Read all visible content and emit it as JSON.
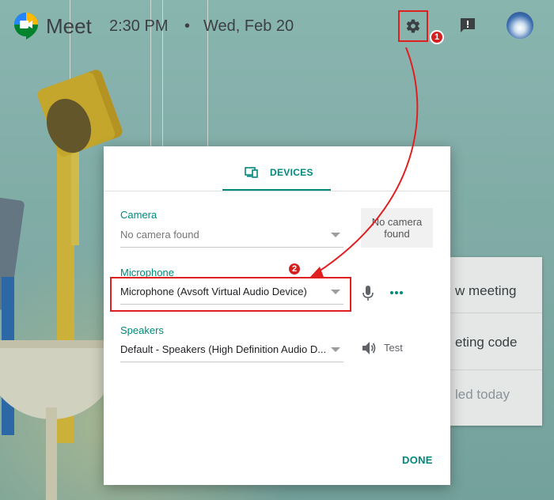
{
  "header": {
    "app_name": "Meet",
    "time": "2:30 PM",
    "separator": "•",
    "date": "Wed, Feb 20",
    "settings_icon": "gear-icon",
    "feedback_icon": "feedback-icon",
    "avatar_icon": "avatar"
  },
  "annotations": {
    "step1": "1",
    "step2": "2",
    "color": "#e02020"
  },
  "background_card": {
    "rows": [
      "w meeting",
      "eting code",
      "led today"
    ]
  },
  "dialog": {
    "tab_label": "DEVICES",
    "tab_icon": "devices-icon",
    "camera": {
      "label": "Camera",
      "value": "No camera found",
      "preview_text": "No camera found"
    },
    "microphone": {
      "label": "Microphone",
      "value": "Microphone (Avsoft Virtual Audio Device)"
    },
    "speakers": {
      "label": "Speakers",
      "value": "Default - Speakers (High Definition Audio D...",
      "test_label": "Test"
    },
    "done_label": "DONE",
    "accent_color": "#00897b"
  }
}
